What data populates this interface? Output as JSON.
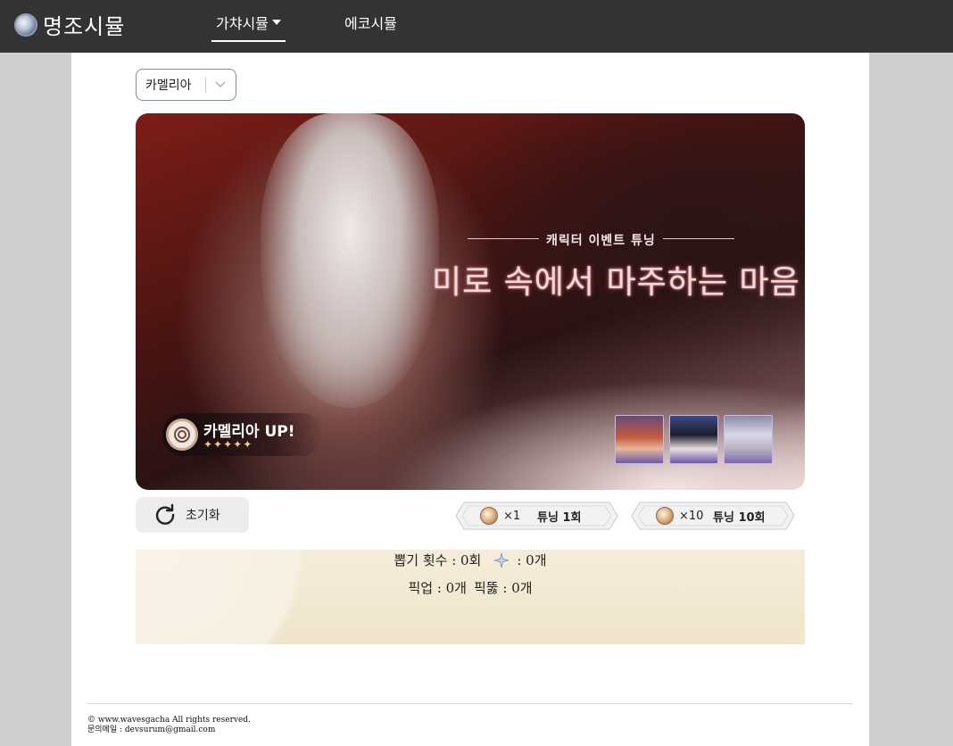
{
  "header": {
    "brand": "명조시뮬",
    "nav": [
      {
        "label": "가챠시뮬",
        "active": true
      },
      {
        "label": "에코시뮬",
        "active": false
      }
    ]
  },
  "banner_select": {
    "value": "카멜리아"
  },
  "banner": {
    "subtitle": "캐릭터 이벤트 튜닝",
    "title": "미로 속에서 마주하는 마음",
    "rate_up_name": "카멜리아 UP!",
    "rate_up_stars": "✦✦✦✦✦",
    "featured_4stars": [
      "portrait-1",
      "portrait-2",
      "portrait-3"
    ]
  },
  "actions": {
    "reset_label": "초기화",
    "pull_1": {
      "multiplier": "×1",
      "label": "튜닝 1회"
    },
    "pull_10": {
      "multiplier": "×10",
      "label": "튜닝 10회"
    }
  },
  "stats": {
    "pull_count_text": "뽑기 횟수 : 0회",
    "five_star_text": ": 0개",
    "pickup_text": "픽업 : 0개",
    "pickup_break_text": "픽뚫 : 0개"
  },
  "footer": {
    "copyright": "© www.wavesgacha All rights reserved.",
    "contact": "문의메일 : devsurum@gmail.com"
  },
  "colors": {
    "topbar": "#333333",
    "page_bg": "#cfcfcf",
    "main_bg": "#ffffff",
    "stats_bg": "#f3ead3"
  }
}
